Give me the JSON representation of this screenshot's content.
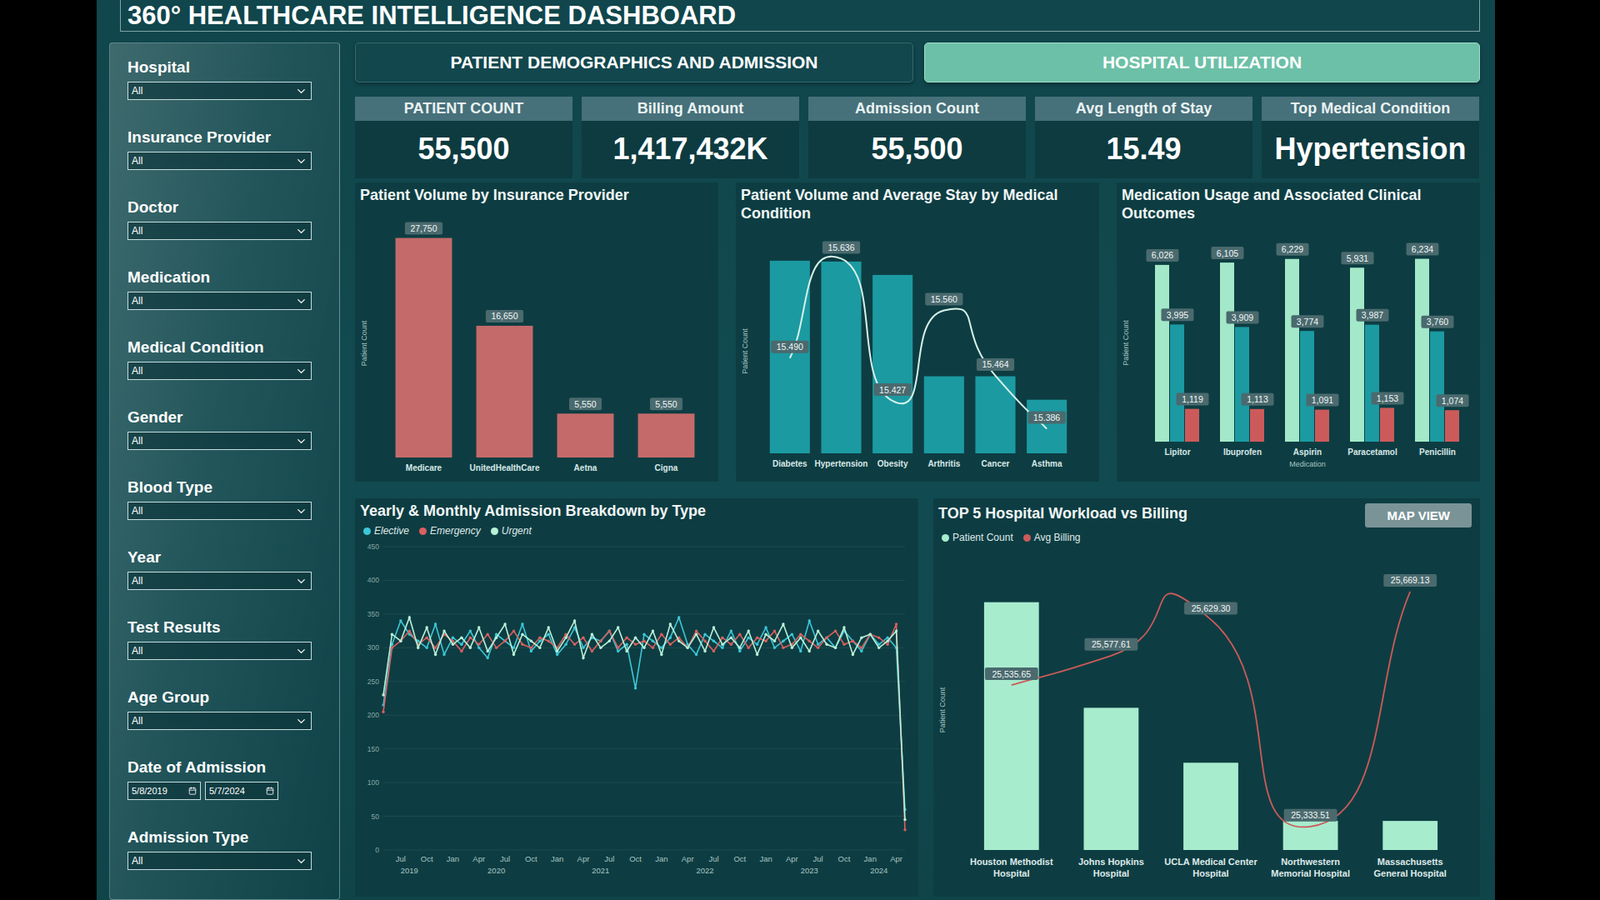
{
  "title": "360° HEALTHCARE INTELLIGENCE DASHBOARD",
  "filters": [
    {
      "label": "Hospital",
      "kind": "dropdown",
      "value": "All"
    },
    {
      "label": "Insurance Provider",
      "kind": "dropdown",
      "value": "All"
    },
    {
      "label": "Doctor",
      "kind": "dropdown",
      "value": "All"
    },
    {
      "label": "Medication",
      "kind": "dropdown",
      "value": "All"
    },
    {
      "label": "Medical Condition",
      "kind": "dropdown",
      "value": "All"
    },
    {
      "label": "Gender",
      "kind": "dropdown",
      "value": "All"
    },
    {
      "label": "Blood Type",
      "kind": "dropdown",
      "value": "All"
    },
    {
      "label": "Year",
      "kind": "dropdown",
      "value": "All"
    },
    {
      "label": "Test Results",
      "kind": "dropdown",
      "value": "All"
    },
    {
      "label": "Age Group",
      "kind": "dropdown",
      "value": "All"
    },
    {
      "label": "Date of Admission",
      "kind": "date-range",
      "from": "5/8/2019",
      "to": "5/7/2024"
    },
    {
      "label": "Admission Type",
      "kind": "dropdown",
      "value": "All"
    }
  ],
  "tabs": [
    {
      "label": "PATIENT DEMOGRAPHICS AND ADMISSION",
      "selected": false
    },
    {
      "label": "HOSPITAL UTILIZATION",
      "selected": true
    }
  ],
  "kpis": [
    {
      "label": "PATIENT COUNT",
      "value": "55,500"
    },
    {
      "label": "Billing Amount",
      "value": "1,417,432K"
    },
    {
      "label": "Admission Count",
      "value": "55,500"
    },
    {
      "label": "Avg Length of Stay",
      "value": "15.49"
    },
    {
      "label": "Top Medical Condition",
      "value": "Hypertension"
    }
  ],
  "charts": {
    "insurance": {
      "title": "Patient Volume by Insurance Provider",
      "y_axis": "Patient Count",
      "categories": [
        "Medicare",
        "UnitedHealthCare",
        "Aetna",
        "Cigna"
      ],
      "values": [
        27750,
        16650,
        5550,
        5550
      ],
      "labels": [
        "27,750",
        "16,650",
        "5,550",
        "5,550"
      ]
    },
    "conditions": {
      "title": "Patient Volume and Average Stay by Medical Condition",
      "y_axis": "Patient Count",
      "categories": [
        "Diabetes",
        "Hypertension",
        "Obesity",
        "Arthritis",
        "Cancer",
        "Asthma"
      ],
      "series": [
        {
          "kind": "bar",
          "color": "#1b9aa2",
          "values": [
            11500,
            11450,
            10650,
            4600,
            4600,
            3200
          ]
        },
        {
          "kind": "line",
          "color": "#d6f2ea",
          "values": [
            15.49,
            15.636,
            15.427,
            15.56,
            15.464,
            15.386
          ],
          "labels": [
            "15.490",
            "15.636",
            "15.427",
            "15.560",
            "15.464",
            "15.386"
          ]
        }
      ]
    },
    "medication": {
      "title": "Medication Usage and Associated Clinical Outcomes",
      "y_axis": "Patient Count",
      "x_axis": "Medication",
      "categories": [
        "Lipitor",
        "Ibuprofen",
        "Aspirin",
        "Paracetamol",
        "Penicillin"
      ],
      "series": [
        {
          "color": "#a3e8c8",
          "values": [
            6026,
            6105,
            6229,
            5931,
            6234
          ],
          "labels": [
            "6,026",
            "6,105",
            "6,229",
            "5,931",
            "6,234"
          ]
        },
        {
          "color": "#1b9aa2",
          "values": [
            3995,
            3909,
            3774,
            3987,
            3760
          ],
          "labels": [
            "3,995",
            "3,909",
            "3,774",
            "3,987",
            "3,760"
          ]
        },
        {
          "color": "#cc5a5a",
          "values": [
            1119,
            1113,
            1091,
            1153,
            1074
          ],
          "labels": [
            "1,119",
            "1,113",
            "1,091",
            "1,153",
            "1,074"
          ]
        }
      ]
    },
    "admissions": {
      "title": "Yearly & Monthly Admission Breakdown by Type",
      "y_ticks": [
        "0",
        "50",
        "100",
        "150",
        "200",
        "250",
        "300",
        "350",
        "400",
        "450"
      ],
      "y_max": 450,
      "x_ticks": [
        {
          "label": "Jul",
          "month": 2
        },
        {
          "label": "Oct",
          "month": 5
        },
        {
          "label": "Jan",
          "month": 8
        },
        {
          "label": "Apr",
          "month": 11
        },
        {
          "label": "Jul",
          "month": 14
        },
        {
          "label": "Oct",
          "month": 17
        },
        {
          "label": "Jan",
          "month": 20
        },
        {
          "label": "Apr",
          "month": 23
        },
        {
          "label": "Jul",
          "month": 26
        },
        {
          "label": "Oct",
          "month": 29
        },
        {
          "label": "Jan",
          "month": 32
        },
        {
          "label": "Apr",
          "month": 35
        },
        {
          "label": "Jul",
          "month": 38
        },
        {
          "label": "Oct",
          "month": 41
        },
        {
          "label": "Jan",
          "month": 44
        },
        {
          "label": "Apr",
          "month": 47
        },
        {
          "label": "Jul",
          "month": 50
        },
        {
          "label": "Oct",
          "month": 53
        },
        {
          "label": "Jan",
          "month": 56
        },
        {
          "label": "Apr",
          "month": 59
        }
      ],
      "years": [
        {
          "label": "2019",
          "month": 3
        },
        {
          "label": "2020",
          "month": 13
        },
        {
          "label": "2021",
          "month": 25
        },
        {
          "label": "2022",
          "month": 37
        },
        {
          "label": "2023",
          "month": 49
        },
        {
          "label": "2024",
          "month": 57
        }
      ],
      "series": [
        {
          "name": "Elective",
          "color": "#3cc7d8",
          "values": [
            215,
            305,
            340,
            320,
            310,
            300,
            335,
            290,
            315,
            305,
            325,
            300,
            285,
            320,
            310,
            300,
            335,
            295,
            310,
            320,
            290,
            305,
            330,
            300,
            315,
            310,
            325,
            295,
            305,
            240,
            320,
            310,
            300,
            315,
            345,
            305,
            290,
            320,
            310,
            300,
            325,
            295,
            315,
            305,
            330,
            300,
            310,
            320,
            295,
            340,
            305,
            315,
            300,
            325,
            310,
            295,
            320,
            305,
            315,
            300,
            60
          ]
        },
        {
          "name": "Emergency",
          "color": "#d9605f",
          "values": [
            205,
            300,
            310,
            325,
            305,
            315,
            300,
            320,
            310,
            295,
            315,
            305,
            320,
            300,
            310,
            325,
            305,
            300,
            315,
            310,
            300,
            320,
            305,
            315,
            295,
            310,
            325,
            300,
            315,
            305,
            310,
            300,
            320,
            305,
            315,
            300,
            325,
            310,
            295,
            315,
            305,
            320,
            300,
            315,
            310,
            325,
            300,
            305,
            320,
            310,
            300,
            315,
            325,
            305,
            310,
            300,
            320,
            315,
            305,
            335,
            30
          ]
        },
        {
          "name": "Urgent",
          "color": "#b8f0d8",
          "values": [
            230,
            320,
            310,
            345,
            300,
            330,
            290,
            325,
            305,
            315,
            300,
            330,
            295,
            315,
            335,
            290,
            320,
            310,
            300,
            330,
            295,
            315,
            340,
            285,
            320,
            300,
            310,
            330,
            295,
            315,
            300,
            325,
            290,
            335,
            310,
            300,
            320,
            295,
            330,
            305,
            315,
            300,
            325,
            290,
            320,
            310,
            335,
            300,
            315,
            295,
            325,
            305,
            300,
            330,
            290,
            315,
            320,
            300,
            310,
            325,
            45
          ]
        }
      ]
    },
    "hospitals": {
      "title": "TOP 5 Hospital Workload vs Billing",
      "button": "MAP VIEW",
      "y_axis": "Patient Count",
      "categories": [
        "Houston Methodist Hospital",
        "Johns Hopkins Hospital",
        "UCLA Medical Center Hospital",
        "Northwestern Memorial Hospital",
        "Massachusetts General Hospital"
      ],
      "series": [
        {
          "name": "Patient Count",
          "kind": "bar",
          "color": "#a8ecce",
          "values": [
            1150,
            660,
            405,
            135,
            135
          ]
        },
        {
          "name": "Avg Billing",
          "kind": "line",
          "color": "#cc5a5a",
          "values": [
            25535.65,
            25577.61,
            25629.3,
            25333.51,
            25669.13
          ],
          "labels": [
            "25,535.65",
            "25,577.61",
            "25,629.30",
            "25,333.51",
            "25,669.13"
          ]
        }
      ]
    }
  }
}
